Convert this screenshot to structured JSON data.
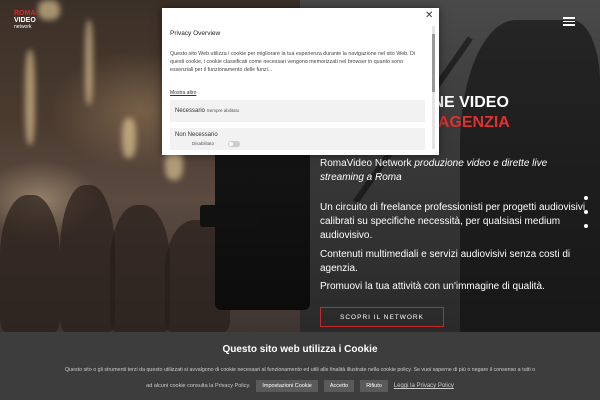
{
  "header": {
    "logo_lines": [
      "ROMA",
      "VIDEO",
      "network"
    ],
    "menu_icon": "hamburger-icon"
  },
  "hero": {
    "title_line1": "ONE VIDEO",
    "title_line2": "DI AGENZIA",
    "tagline_brand": "RomaVideo Network",
    "tagline_rest": "produzione video e dirette live streaming a Roma",
    "paragraphs": [
      "Un circuito di freelance professionisti per progetti audiovisivi calibrati su specifiche necessità, per qualsiasi medium audiovisivo.",
      "Contenuti multimediali e servizi audiovisivi senza costi di agenzia.",
      "Promuovi la tua attività con un'immagine di qualità."
    ],
    "cta_label": "SCOPRI IL NETWORK"
  },
  "privacy_modal": {
    "title": "Privacy Overview",
    "body": "Questo sito Web utilizza i cookie per migliorare la tua esperienza durante la navigazione nel sito Web. Di questi cookie, i cookie classificati come necessari vengono memorizzati nel browser in quanto sono essenziali per il funzionamento delle funzi...",
    "more_link": "Mostra altro",
    "necessary_label": "Necessario",
    "necessary_status": "Sempre abilitato",
    "not_necessary_label": "Non Necessario",
    "not_necessary_status": "Disabilitato",
    "close_icon": "close-icon"
  },
  "cookie_bar": {
    "title": "Questo sito web utilizza i Cookie",
    "text": "Questo sito o gli strumenti terzi da questo utilizzati si avvalgono di cookie necessari al funzionamento ed utili alle finalità illustrate nella cookie policy. Se vuoi saperne di più o negare il consenso a tutti o",
    "text2": "ad alcuni cookie consulta la Privacy Policy.",
    "settings_label": "Impostazioni Cookie",
    "accept_label": "Accetto",
    "reject_label": "Rifiuto",
    "policy_link": "Leggi la Privacy Policy"
  },
  "colors": {
    "accent_red": "#d42a2a",
    "cookie_bar_bg": "#3d3d3d",
    "button_gray": "#5a5a5a"
  }
}
